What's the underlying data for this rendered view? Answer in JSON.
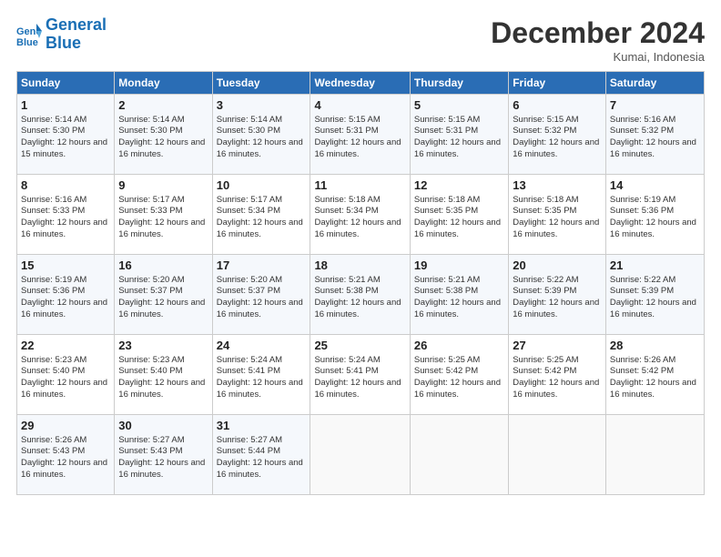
{
  "logo": {
    "line1": "General",
    "line2": "Blue"
  },
  "title": "December 2024",
  "location": "Kumai, Indonesia",
  "days_of_week": [
    "Sunday",
    "Monday",
    "Tuesday",
    "Wednesday",
    "Thursday",
    "Friday",
    "Saturday"
  ],
  "weeks": [
    [
      {
        "day": 1,
        "sunrise": "5:14 AM",
        "sunset": "5:30 PM",
        "daylight": "12 hours and 15 minutes."
      },
      {
        "day": 2,
        "sunrise": "5:14 AM",
        "sunset": "5:30 PM",
        "daylight": "12 hours and 16 minutes."
      },
      {
        "day": 3,
        "sunrise": "5:14 AM",
        "sunset": "5:30 PM",
        "daylight": "12 hours and 16 minutes."
      },
      {
        "day": 4,
        "sunrise": "5:15 AM",
        "sunset": "5:31 PM",
        "daylight": "12 hours and 16 minutes."
      },
      {
        "day": 5,
        "sunrise": "5:15 AM",
        "sunset": "5:31 PM",
        "daylight": "12 hours and 16 minutes."
      },
      {
        "day": 6,
        "sunrise": "5:15 AM",
        "sunset": "5:32 PM",
        "daylight": "12 hours and 16 minutes."
      },
      {
        "day": 7,
        "sunrise": "5:16 AM",
        "sunset": "5:32 PM",
        "daylight": "12 hours and 16 minutes."
      }
    ],
    [
      {
        "day": 8,
        "sunrise": "5:16 AM",
        "sunset": "5:33 PM",
        "daylight": "12 hours and 16 minutes."
      },
      {
        "day": 9,
        "sunrise": "5:17 AM",
        "sunset": "5:33 PM",
        "daylight": "12 hours and 16 minutes."
      },
      {
        "day": 10,
        "sunrise": "5:17 AM",
        "sunset": "5:34 PM",
        "daylight": "12 hours and 16 minutes."
      },
      {
        "day": 11,
        "sunrise": "5:18 AM",
        "sunset": "5:34 PM",
        "daylight": "12 hours and 16 minutes."
      },
      {
        "day": 12,
        "sunrise": "5:18 AM",
        "sunset": "5:35 PM",
        "daylight": "12 hours and 16 minutes."
      },
      {
        "day": 13,
        "sunrise": "5:18 AM",
        "sunset": "5:35 PM",
        "daylight": "12 hours and 16 minutes."
      },
      {
        "day": 14,
        "sunrise": "5:19 AM",
        "sunset": "5:36 PM",
        "daylight": "12 hours and 16 minutes."
      }
    ],
    [
      {
        "day": 15,
        "sunrise": "5:19 AM",
        "sunset": "5:36 PM",
        "daylight": "12 hours and 16 minutes."
      },
      {
        "day": 16,
        "sunrise": "5:20 AM",
        "sunset": "5:37 PM",
        "daylight": "12 hours and 16 minutes."
      },
      {
        "day": 17,
        "sunrise": "5:20 AM",
        "sunset": "5:37 PM",
        "daylight": "12 hours and 16 minutes."
      },
      {
        "day": 18,
        "sunrise": "5:21 AM",
        "sunset": "5:38 PM",
        "daylight": "12 hours and 16 minutes."
      },
      {
        "day": 19,
        "sunrise": "5:21 AM",
        "sunset": "5:38 PM",
        "daylight": "12 hours and 16 minutes."
      },
      {
        "day": 20,
        "sunrise": "5:22 AM",
        "sunset": "5:39 PM",
        "daylight": "12 hours and 16 minutes."
      },
      {
        "day": 21,
        "sunrise": "5:22 AM",
        "sunset": "5:39 PM",
        "daylight": "12 hours and 16 minutes."
      }
    ],
    [
      {
        "day": 22,
        "sunrise": "5:23 AM",
        "sunset": "5:40 PM",
        "daylight": "12 hours and 16 minutes."
      },
      {
        "day": 23,
        "sunrise": "5:23 AM",
        "sunset": "5:40 PM",
        "daylight": "12 hours and 16 minutes."
      },
      {
        "day": 24,
        "sunrise": "5:24 AM",
        "sunset": "5:41 PM",
        "daylight": "12 hours and 16 minutes."
      },
      {
        "day": 25,
        "sunrise": "5:24 AM",
        "sunset": "5:41 PM",
        "daylight": "12 hours and 16 minutes."
      },
      {
        "day": 26,
        "sunrise": "5:25 AM",
        "sunset": "5:42 PM",
        "daylight": "12 hours and 16 minutes."
      },
      {
        "day": 27,
        "sunrise": "5:25 AM",
        "sunset": "5:42 PM",
        "daylight": "12 hours and 16 minutes."
      },
      {
        "day": 28,
        "sunrise": "5:26 AM",
        "sunset": "5:42 PM",
        "daylight": "12 hours and 16 minutes."
      }
    ],
    [
      {
        "day": 29,
        "sunrise": "5:26 AM",
        "sunset": "5:43 PM",
        "daylight": "12 hours and 16 minutes."
      },
      {
        "day": 30,
        "sunrise": "5:27 AM",
        "sunset": "5:43 PM",
        "daylight": "12 hours and 16 minutes."
      },
      {
        "day": 31,
        "sunrise": "5:27 AM",
        "sunset": "5:44 PM",
        "daylight": "12 hours and 16 minutes."
      },
      null,
      null,
      null,
      null
    ]
  ]
}
